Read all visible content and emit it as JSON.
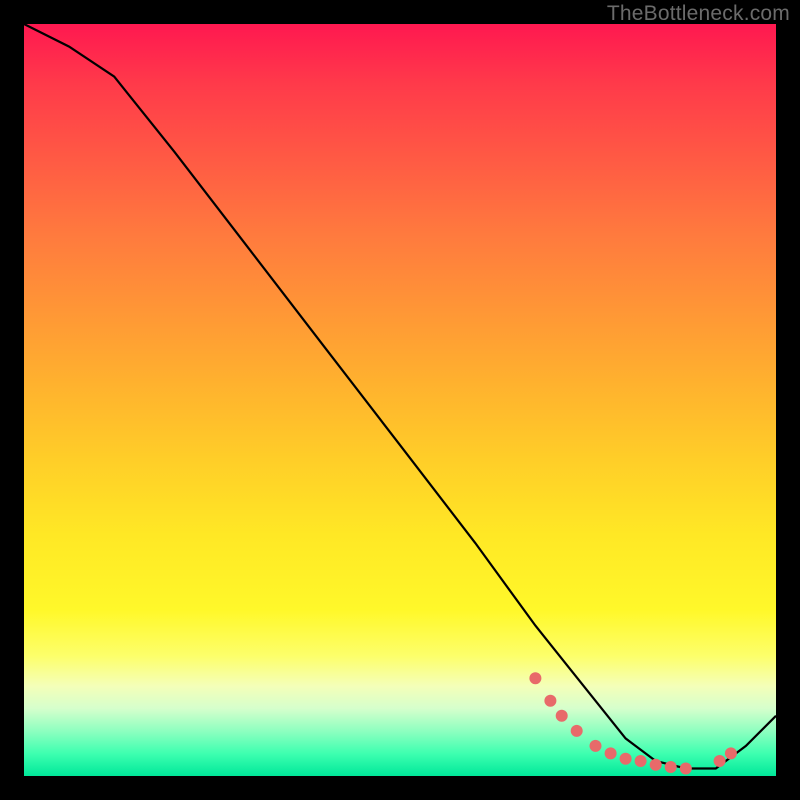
{
  "watermark": "TheBottleneck.com",
  "chart_data": {
    "type": "line",
    "title": "",
    "xlabel": "",
    "ylabel": "",
    "xlim": [
      0,
      100
    ],
    "ylim": [
      0,
      100
    ],
    "series": [
      {
        "name": "curve",
        "color": "#000000",
        "x": [
          0,
          6,
          12,
          20,
          30,
          40,
          50,
          60,
          68,
          72,
          76,
          80,
          84,
          88,
          92,
          96,
          100
        ],
        "values": [
          100,
          97,
          93,
          83,
          70,
          57,
          44,
          31,
          20,
          15,
          10,
          5,
          2,
          1,
          1,
          4,
          8
        ]
      }
    ],
    "markers": {
      "name": "dots",
      "color": "#e86a6a",
      "radius": 6,
      "x": [
        68,
        70,
        71.5,
        73.5,
        76,
        78,
        80,
        82,
        84,
        86,
        88,
        92.5,
        94
      ],
      "values": [
        13,
        10,
        8,
        6,
        4,
        3,
        2.3,
        2,
        1.5,
        1.2,
        1,
        2,
        3
      ]
    }
  }
}
